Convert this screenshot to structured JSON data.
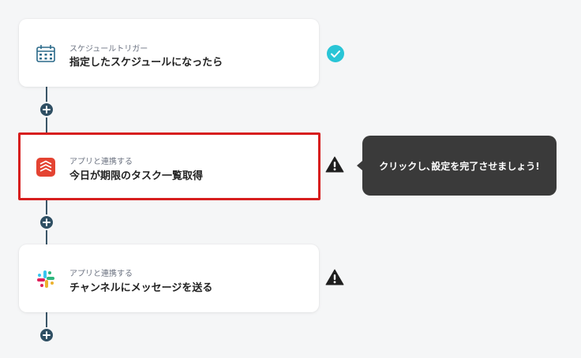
{
  "flow": {
    "steps": [
      {
        "subtitle": "スケジュールトリガー",
        "title": "指定したスケジュールになったら",
        "icon": "calendar-icon",
        "status": "check-circle-icon"
      },
      {
        "subtitle": "アプリと連携する",
        "title": "今日が期限のタスク一覧取得",
        "icon": "todoist-icon",
        "status": "warning-icon"
      },
      {
        "subtitle": "アプリと連携する",
        "title": "チャンネルにメッセージを送る",
        "icon": "slack-icon",
        "status": "warning-icon"
      }
    ],
    "add_buttons": [
      "plus-icon",
      "plus-icon",
      "plus-icon"
    ]
  },
  "tooltip": {
    "text": "クリックし､設定を完了させましょう!"
  },
  "colors": {
    "background": "#f5f6f7",
    "connector": "#3b5668",
    "check": "#29c5d6",
    "highlight_border": "#d71e1e",
    "tooltip_bg": "#3a3a3a",
    "todoist": "#e44332"
  }
}
